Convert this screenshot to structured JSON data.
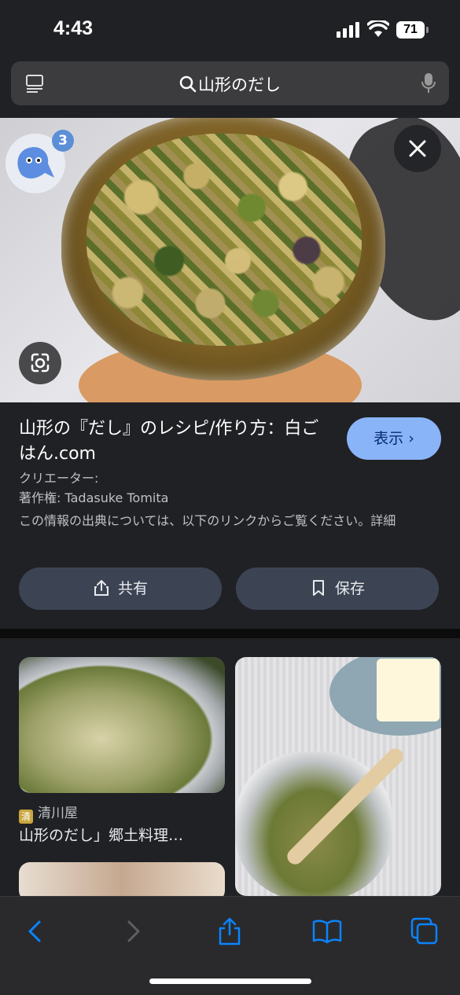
{
  "status": {
    "time": "4:43",
    "battery": "71"
  },
  "search": {
    "query": "山形のだし"
  },
  "hero": {
    "badge_count": "3"
  },
  "result": {
    "title": "山形の『だし』のレシピ/作り方：白ごはん.com",
    "visit_label": "表示 ›",
    "creator": "クリエーター:",
    "copyright": "著作権: Tadasuke Tomita",
    "source_note": "この情報の出典については、以下のリンクからご覧ください。詳細",
    "share_label": "共有",
    "save_label": "保存"
  },
  "related": [
    {
      "source": "清川屋",
      "title": "山形のだし」郷土料理…"
    }
  ],
  "colors": {
    "accent": "#8ab4f8",
    "ios_blue": "#0a84ff"
  }
}
